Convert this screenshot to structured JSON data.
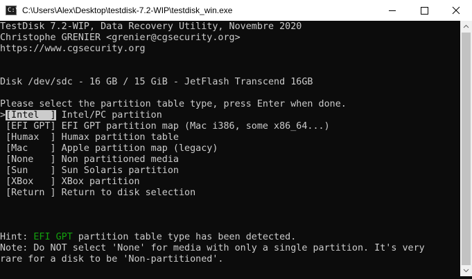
{
  "window": {
    "title": "C:\\Users\\Alex\\Desktop\\testdisk-7.2-WIP\\testdisk_win.exe",
    "icon_prompt": "C:\\"
  },
  "header": {
    "line1": "TestDisk 7.2-WIP, Data Recovery Utility, Novembre 2020",
    "line2": "Christophe GRENIER <grenier@cgsecurity.org>",
    "line3": "https://www.cgsecurity.org"
  },
  "disk_info": "Disk /dev/sdc - 16 GB / 15 GiB - JetFlash Transcend 16GB",
  "prompt": "Please select the partition table type, press Enter when done.",
  "options": [
    {
      "key": "[Intel  ]",
      "desc": " Intel/PC partition",
      "selected": true
    },
    {
      "key": "[EFI GPT]",
      "desc": " EFI GPT partition map (Mac i386, some x86_64...)",
      "selected": false
    },
    {
      "key": "[Humax  ]",
      "desc": " Humax partition table",
      "selected": false
    },
    {
      "key": "[Mac    ]",
      "desc": " Apple partition map (legacy)",
      "selected": false
    },
    {
      "key": "[None   ]",
      "desc": " Non partitioned media",
      "selected": false
    },
    {
      "key": "[Sun    ]",
      "desc": " Sun Solaris partition",
      "selected": false
    },
    {
      "key": "[XBox   ]",
      "desc": " XBox partition",
      "selected": false
    },
    {
      "key": "[Return ]",
      "desc": " Return to disk selection",
      "selected": false
    }
  ],
  "hint": {
    "prefix": "Hint: ",
    "highlight": "EFI GPT",
    "suffix": " partition table type has been detected."
  },
  "note": {
    "line1": "Note: Do NOT select 'None' for media with only a single partition. It's very",
    "line2": "rare for a disk to be 'Non-partitioned'."
  },
  "colors": {
    "background": "#0c0c0c",
    "text": "#cccccc",
    "hint_highlight": "#13a10e",
    "selection_bg": "#cccccc"
  },
  "icons": [
    "console-app-icon",
    "minimize-icon",
    "maximize-icon",
    "close-icon",
    "scroll-up-icon",
    "scroll-down-icon"
  ]
}
